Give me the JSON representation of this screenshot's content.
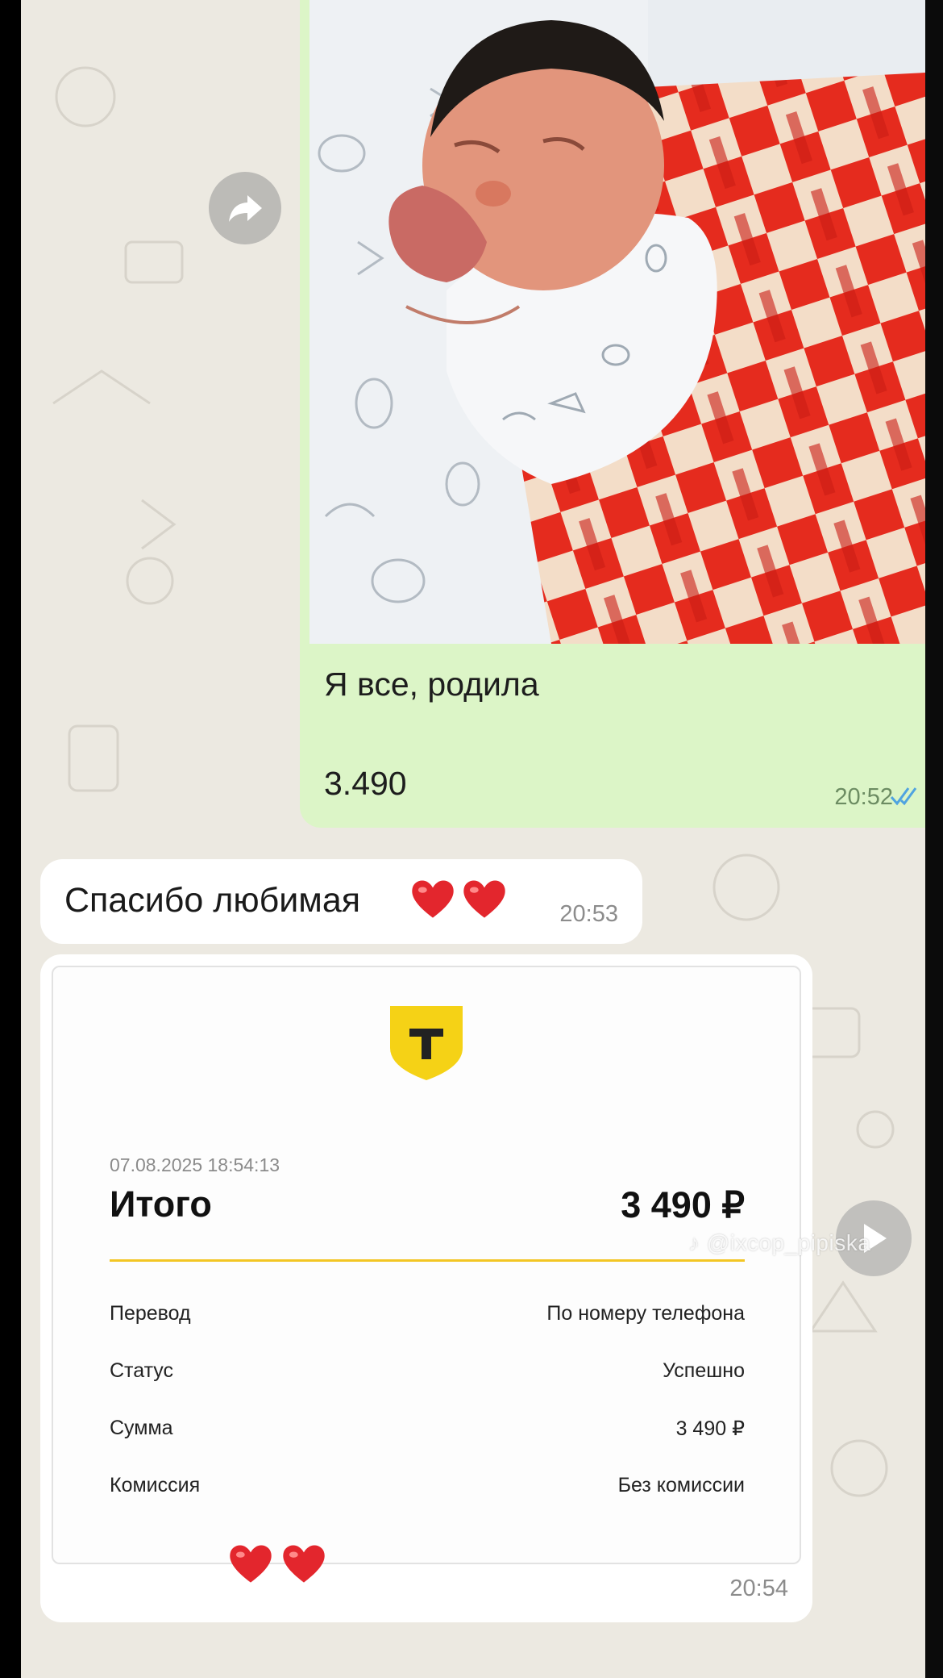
{
  "outgoing_message": {
    "photo_icon": "newborn-photo",
    "text": "Я все, родила",
    "number": "3.490",
    "time": "20:52",
    "status_icon": "double-check-read-icon",
    "status_color": "#4fa3e0"
  },
  "forward_button": {
    "icon": "share-forward-icon"
  },
  "incoming_message": {
    "text": "Спасибо любимая",
    "hearts": [
      "❤️",
      "❤️"
    ],
    "time": "20:53"
  },
  "receipt_message": {
    "logo_letter": "Т",
    "logo_color": "#f5d216",
    "datetime": "07.08.2025 18:54:13",
    "total_label": "Итого",
    "total_value": "3 490 ₽",
    "accent_color": "#f3c624",
    "rows": [
      {
        "label": "Перевод",
        "value": "По номеру телефона"
      },
      {
        "label": "Статус",
        "value": "Успешно"
      },
      {
        "label": "Сумма",
        "value": "3 490 ₽"
      },
      {
        "label": "Комиссия",
        "value": "Без комиссии"
      }
    ],
    "hearts": [
      "❤️",
      "❤️"
    ],
    "time": "20:54"
  },
  "play_button": {
    "icon": "play-icon"
  },
  "watermark": {
    "text": "@ixcop_pipiska",
    "icon": "tiktok-icon"
  }
}
